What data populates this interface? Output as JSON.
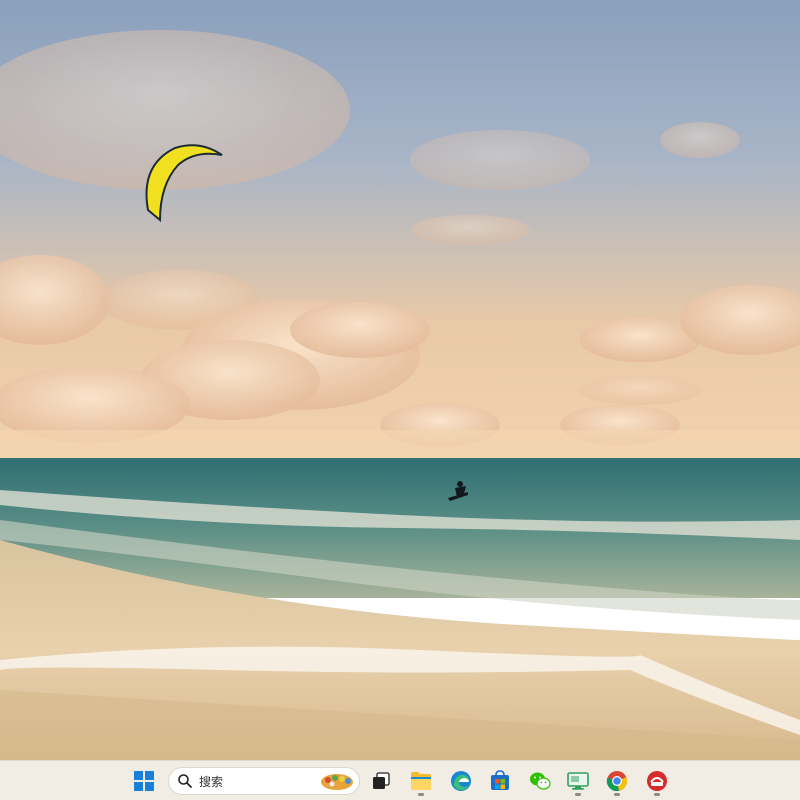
{
  "desktop": {
    "wallpaper": "beach-kitesurfer-sunset"
  },
  "taskbar": {
    "background": "#f1ece4",
    "search": {
      "placeholder": "搜索"
    },
    "items": [
      {
        "name": "start-button",
        "icon": "windows-logo-icon"
      },
      {
        "name": "task-view-button",
        "icon": "task-view-icon"
      },
      {
        "name": "file-explorer-button",
        "icon": "folder-icon",
        "running": true
      },
      {
        "name": "edge-button",
        "icon": "edge-browser-icon"
      },
      {
        "name": "store-button",
        "icon": "microsoft-store-icon"
      },
      {
        "name": "wechat-button",
        "icon": "wechat-icon"
      },
      {
        "name": "remote-desktop-button",
        "icon": "monitor-icon",
        "running": true
      },
      {
        "name": "chrome-button",
        "icon": "chrome-icon",
        "running": true
      },
      {
        "name": "app-button",
        "icon": "red-app-icon",
        "running": true
      }
    ]
  }
}
